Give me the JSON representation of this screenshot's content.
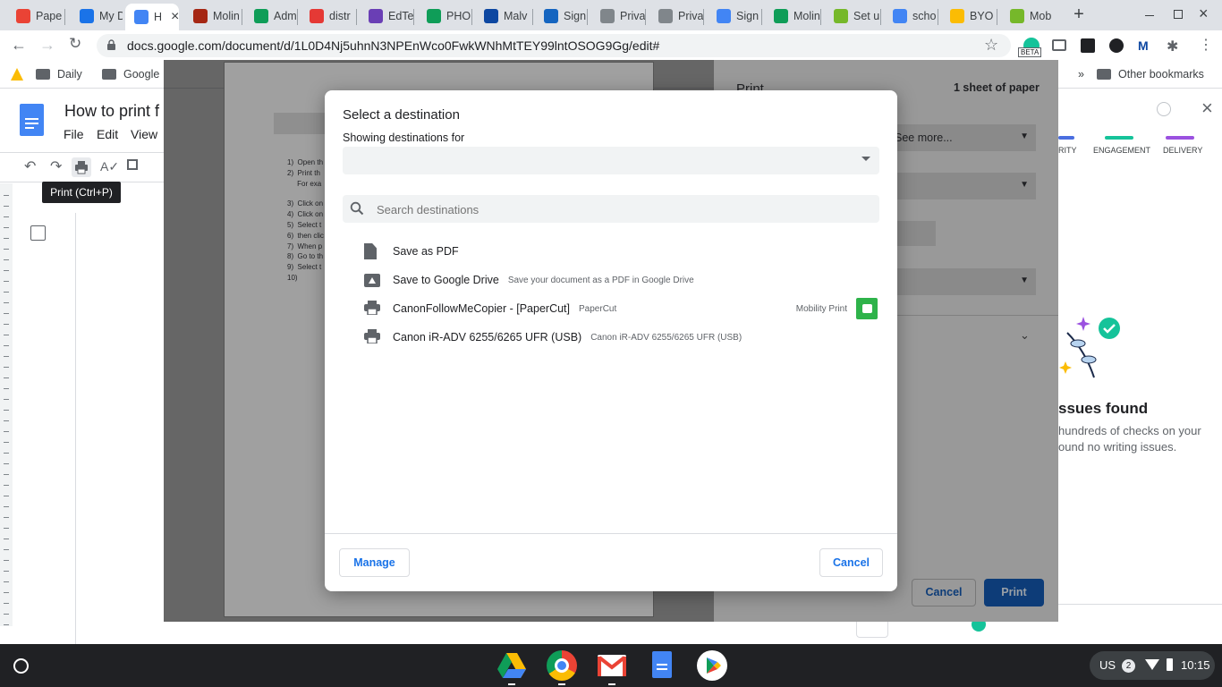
{
  "browser": {
    "tabs": [
      {
        "label": "Pape",
        "icon": "gmail-icon",
        "color": "#ea4335"
      },
      {
        "label": "My D",
        "icon": "drive-icon",
        "color": "#1a73e8"
      },
      {
        "label": "H",
        "icon": "docs-icon",
        "color": "#4285f4",
        "active": true
      },
      {
        "label": "Molin",
        "icon": "gmail-icon",
        "color": "#a52714"
      },
      {
        "label": "Adm",
        "icon": "sheets-icon",
        "color": "#0f9d58"
      },
      {
        "label": "distr",
        "icon": "pdf-icon",
        "color": "#e53935"
      },
      {
        "label": "EdTe",
        "icon": "k-icon",
        "color": "#6a3fb5"
      },
      {
        "label": "PHO",
        "icon": "sheets-icon",
        "color": "#0f9d58"
      },
      {
        "label": "Malv",
        "icon": "malwarebytes-icon",
        "color": "#0d47a1"
      },
      {
        "label": "Sign",
        "icon": "signin-icon",
        "color": "#1565c0"
      },
      {
        "label": "Priva",
        "icon": "globe-icon",
        "color": "#80868b"
      },
      {
        "label": "Priva",
        "icon": "globe-icon",
        "color": "#80868b"
      },
      {
        "label": "Sign",
        "icon": "google-icon",
        "color": "#4285f4"
      },
      {
        "label": "Molin",
        "icon": "sheets-icon",
        "color": "#0f9d58"
      },
      {
        "label": "Set u",
        "icon": "papercut-icon",
        "color": "#76b82a"
      },
      {
        "label": "scho",
        "icon": "google-icon",
        "color": "#4285f4"
      },
      {
        "label": "BYO",
        "icon": "drive-icon",
        "color": "#fbbc04"
      },
      {
        "label": "Mob",
        "icon": "papercut-icon",
        "color": "#76b82a"
      }
    ],
    "url": "docs.google.com/document/d/1L0D4Nj5uhnN3NPEnWco0FwkWNhMtTEY99lntOSOG9Gg/edit#",
    "beta_label": "BETA",
    "bookmarks": [
      "Daily",
      "Google"
    ],
    "other_bookmarks": "Other bookmarks"
  },
  "docs": {
    "title": "How to print f",
    "menu": [
      "File",
      "Edit",
      "View"
    ],
    "tooltip": "Print (Ctrl+P)",
    "doc_lines": [
      "1)  Open th",
      "2)  Print th",
      "     For exa",
      "3)  Click on",
      "4)  Click on",
      "5)  Select t",
      "6)  then clic",
      "7)  When p",
      "8)  Go to th",
      "9)  Select t",
      "10)"
    ]
  },
  "print_panel": {
    "title": "Print",
    "sheets": "1 sheet of paper",
    "see_more": "See more...",
    "cancel": "Cancel",
    "print": "Print"
  },
  "grammarly": {
    "tabs": [
      "RITY",
      "ENGAGEMENT",
      "DELIVERY"
    ],
    "tab_colors": [
      "#4a6ee0",
      "#15c39a",
      "#9b51e0"
    ],
    "heading": "ssues found",
    "body_line1": "hundreds of checks on your",
    "body_line2": "ound no writing issues."
  },
  "dialog": {
    "title": "Select a destination",
    "showing_label": "Showing destinations for",
    "search_placeholder": "Search destinations",
    "destinations": [
      {
        "name": "Save as PDF",
        "sub": "",
        "icon": "file-icon"
      },
      {
        "name": "Save to Google Drive",
        "sub": "Save your document as a PDF in Google Drive",
        "icon": "drive-icon"
      },
      {
        "name": "CanonFollowMeCopier - [PaperCut]",
        "sub": "PaperCut",
        "icon": "printer-icon",
        "extension": "Mobility Print"
      },
      {
        "name": "Canon iR-ADV 6255/6265 UFR (USB)",
        "sub": "Canon iR-ADV 6255/6265 UFR (USB)",
        "icon": "printer-icon"
      }
    ],
    "manage": "Manage",
    "cancel": "Cancel"
  },
  "shelf": {
    "apps": [
      "drive-icon",
      "chrome-icon",
      "gmail-icon",
      "docs-icon",
      "play-store-icon"
    ],
    "locale": "US",
    "notifications": "2",
    "time": "10:15"
  }
}
